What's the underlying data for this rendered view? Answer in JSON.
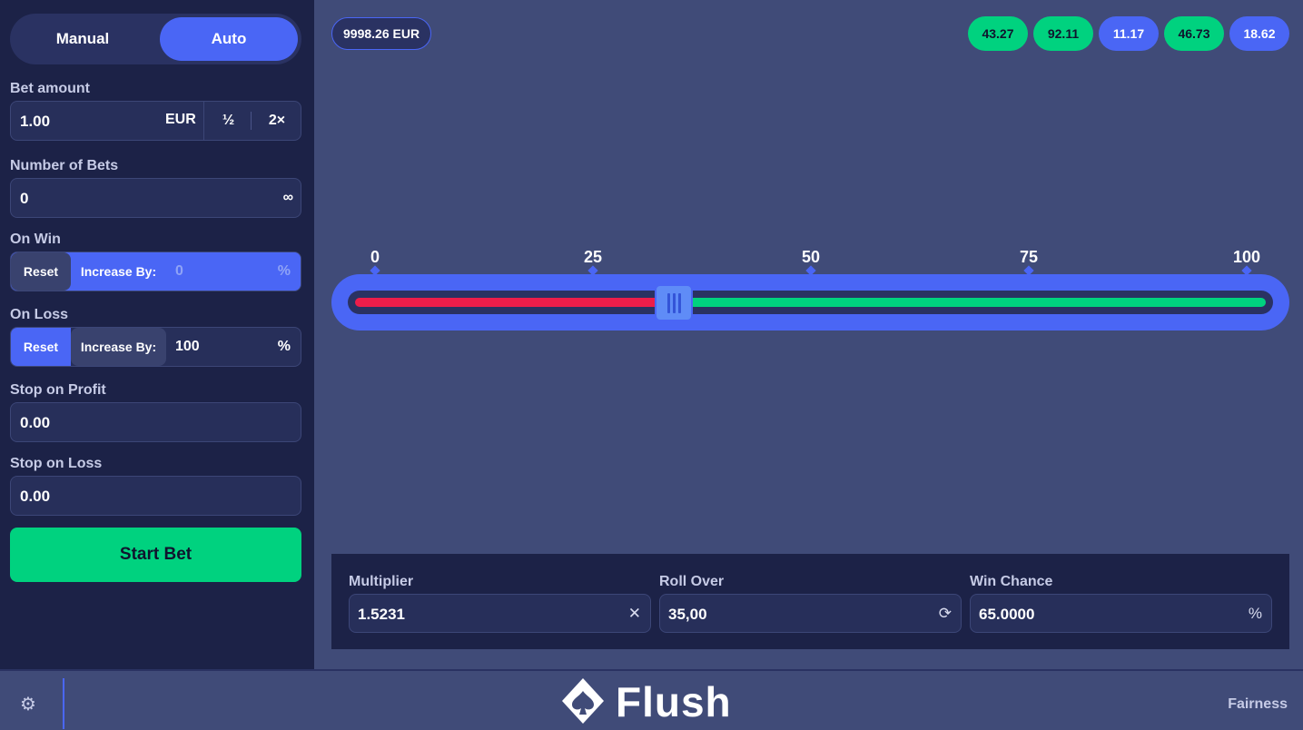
{
  "mode": {
    "manual": "Manual",
    "auto": "Auto",
    "selected": "Auto"
  },
  "bet_amount": {
    "label": "Bet amount",
    "value": "1.00",
    "currency": "EUR",
    "half": "½",
    "double": "2×"
  },
  "number_of_bets": {
    "label": "Number of Bets",
    "value": "0",
    "infinite": "∞"
  },
  "on_win": {
    "label": "On Win",
    "reset": "Reset",
    "increase": "Increase By:",
    "value": "0",
    "unit": "%"
  },
  "on_loss": {
    "label": "On Loss",
    "reset": "Reset",
    "increase": "Increase By:",
    "value": "100",
    "unit": "%"
  },
  "stop_on_profit": {
    "label": "Stop on Profit",
    "value": "0.00"
  },
  "stop_on_loss": {
    "label": "Stop on Loss",
    "value": "0.00"
  },
  "start_button": "Start Bet",
  "balance": "9998.26 EUR",
  "history": [
    {
      "value": "43.27",
      "result": "win"
    },
    {
      "value": "92.11",
      "result": "win"
    },
    {
      "value": "11.17",
      "result": "loss"
    },
    {
      "value": "46.73",
      "result": "win"
    },
    {
      "value": "18.62",
      "result": "loss"
    }
  ],
  "slider": {
    "ticks": [
      "0",
      "25",
      "50",
      "75",
      "100"
    ],
    "value": 35
  },
  "multiplier": {
    "label": "Multiplier",
    "value": "1.5231",
    "icon": "close-icon"
  },
  "roll_over": {
    "label": "Roll Over",
    "value": "35,00",
    "icon": "refresh-icon"
  },
  "win_chance": {
    "label": "Win Chance",
    "value": "65.0000",
    "unit": "%"
  },
  "footer": {
    "brand": "Flush",
    "fairness": "Fairness"
  },
  "colors": {
    "accent": "#4a66f5",
    "win": "#00d27f",
    "loss": "#ee1d4a",
    "panel": "#1c2247",
    "background": "#404b78"
  }
}
